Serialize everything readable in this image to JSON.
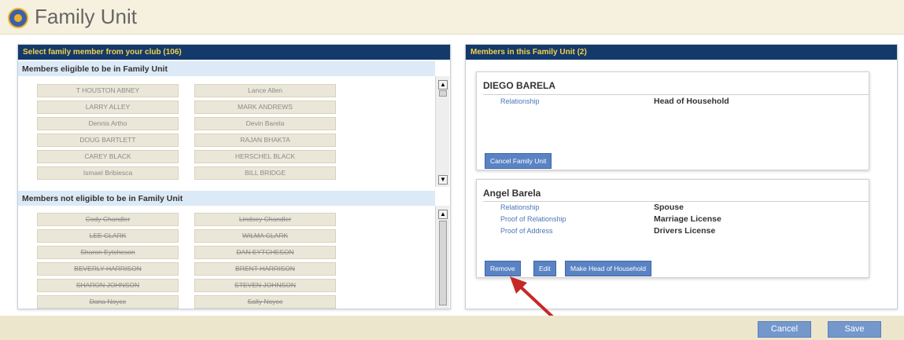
{
  "header": {
    "title": "Family Unit",
    "logo_icon": "lions-club-logo-icon"
  },
  "left_panel": {
    "title": "Select family member from your club (106)",
    "eligible": {
      "heading": "Members eligible to be in Family Unit",
      "members": [
        "T HOUSTON ABNEY",
        "Lance Allen",
        "LARRY ALLEY",
        "MARK ANDREWS",
        "Dennis Artho",
        "Devin Barela",
        "DOUG BARTLETT",
        "RAJAN BHAKTA",
        "CAREY BLACK",
        "HERSCHEL BLACK",
        "Ismael Bribiesca",
        "BILL BRIDGE"
      ]
    },
    "not_eligible": {
      "heading": "Members not eligible to be in Family Unit",
      "members": [
        "Cody Chandler",
        "Lindsey Chandler",
        "LEE CLARK",
        "WILMA CLARK",
        "Sharon Eytcheson",
        "DAN EYTCHESON",
        "BEVERLY HARRISON",
        "BRENT HARRISON",
        "SHARON JOHNSON",
        "STEVEN JOHNSON",
        "Dana Noyce",
        "Sally Noyce"
      ]
    }
  },
  "right_panel": {
    "title": "Members in this Family Unit (2)",
    "cards": [
      {
        "name": "DIEGO BARELA",
        "rows": [
          {
            "label": "Relationship",
            "value": "Head of Household"
          }
        ],
        "buttons": [
          "Cancel Family Unit"
        ]
      },
      {
        "name": "Angel Barela",
        "rows": [
          {
            "label": "Relationship",
            "value": "Spouse"
          },
          {
            "label": "Proof of Relationship",
            "value": "Marriage License"
          },
          {
            "label": "Proof of Address",
            "value": "Drivers License"
          }
        ],
        "buttons": [
          "Remove",
          "Edit",
          "Make Head of Household"
        ]
      }
    ]
  },
  "footer": {
    "cancel_label": "Cancel",
    "save_label": "Save"
  },
  "colors": {
    "panel_header": "#14396b",
    "panel_header_text": "#f1d24a",
    "link_blue": "#4a77b8",
    "button_blue": "#5a83c4",
    "annotation_arrow": "#c62828"
  }
}
